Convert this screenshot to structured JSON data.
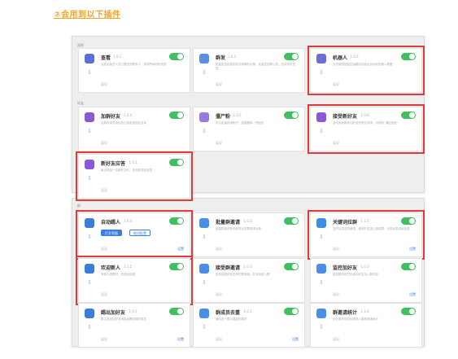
{
  "heading": "②会用到以下插件",
  "panel1": {
    "sec_a": "消息",
    "sec_b": "好友",
    "cards": [
      {
        "name": "查看",
        "ver": "1.0.1",
        "desc": "当发出某些人员已是这些联系人，将你所询问的信息",
        "show": "展现",
        "icon": "#5b6fd6"
      },
      {
        "name": "群发",
        "ver": "1.0.1",
        "desc": "批量发送信息到好友和群的对象，批量发送群公告，支持定时发送",
        "show": "展现",
        "icon": "#5b8fe6"
      },
      {
        "name": "机器人",
        "ver": "1.0.5",
        "desc": "当关键词回复的话题自动给出自动化机器人看看",
        "show": "展现",
        "icon": "#6c6fd6"
      },
      {
        "name": "加群好友",
        "ver": "1.0.4",
        "desc": "当群内成员添加自己后发送好友自动",
        "show": "展现",
        "icon": "#8b5ad6"
      },
      {
        "name": "僵尸粉",
        "ver": "1.0.2",
        "desc": "可以批量检测帐户，批量删除一些回应",
        "show": "展现",
        "icon": "#9a7ade"
      },
      {
        "name": "接受新好友",
        "ver": "1.0.6",
        "desc": "自动添加和你加好友的好友请求，可添加“通过验证”",
        "show": "展现",
        "icon": "#8a5ad6"
      },
      {
        "name": "新好友应答",
        "ver": "1.0.1",
        "desc": "每当添加一位新好友时，自动发送欢迎语",
        "show": "展现",
        "icon": "#8a5ad6"
      }
    ]
  },
  "panel2": {
    "sec": "群",
    "btn_open": "打开界面",
    "btn_cancel": "取消配置",
    "cards": [
      {
        "name": "自动踢人",
        "ver": "1.0.4",
        "desc": "",
        "show": "展现",
        "setting": "设置",
        "icon": "#3b7ddd"
      },
      {
        "name": "批量群邀请",
        "ver": "1.0.2",
        "desc": "批量群邀请到全部好友的群邀请对象",
        "show": "展现",
        "setting": "",
        "icon": "#4a8ee6"
      },
      {
        "name": "关键词拉群",
        "ver": "1.1.5",
        "desc": "当好友发送关键词，邀请好友进入相应群，可自动发送欢迎语",
        "show": "展现",
        "setting": "设置",
        "icon": "#3b8ee6"
      },
      {
        "name": "欢迎新人",
        "ver": "1.1.5",
        "desc": "有新人进群时，发送欢迎语",
        "show": "展现",
        "setting": "",
        "icon": "#3b7ddd"
      },
      {
        "name": "接受群邀请",
        "ver": "1.0.3",
        "desc": "自动接受好友发来的群邀请，并自动进入群",
        "show": "展现",
        "setting": "",
        "icon": "#4a8ee6"
      },
      {
        "name": "监控加好友",
        "ver": "1.0.3",
        "desc": "监控群内成员的自动好友加入群内容",
        "show": "展现",
        "setting": "设置",
        "icon": "#4a8ee6"
      },
      {
        "name": "踢出加好友",
        "ver": "1.0.2",
        "desc": "群主发送加好友消息给踢出群的成员",
        "show": "展现",
        "setting": "设置",
        "icon": "#3b7ddd"
      },
      {
        "name": "群成员去重",
        "ver": "1.0.1",
        "desc": "清除多个群中重复的成员",
        "show": "展现",
        "setting": "设置",
        "icon": "#4a8ee6"
      },
      {
        "name": "群邀请统计",
        "ver": "1.1.0",
        "desc": "统计群内成员的邀请人数和邀请统计",
        "show": "展现",
        "setting": "",
        "icon": "#4a8ee6"
      }
    ]
  }
}
